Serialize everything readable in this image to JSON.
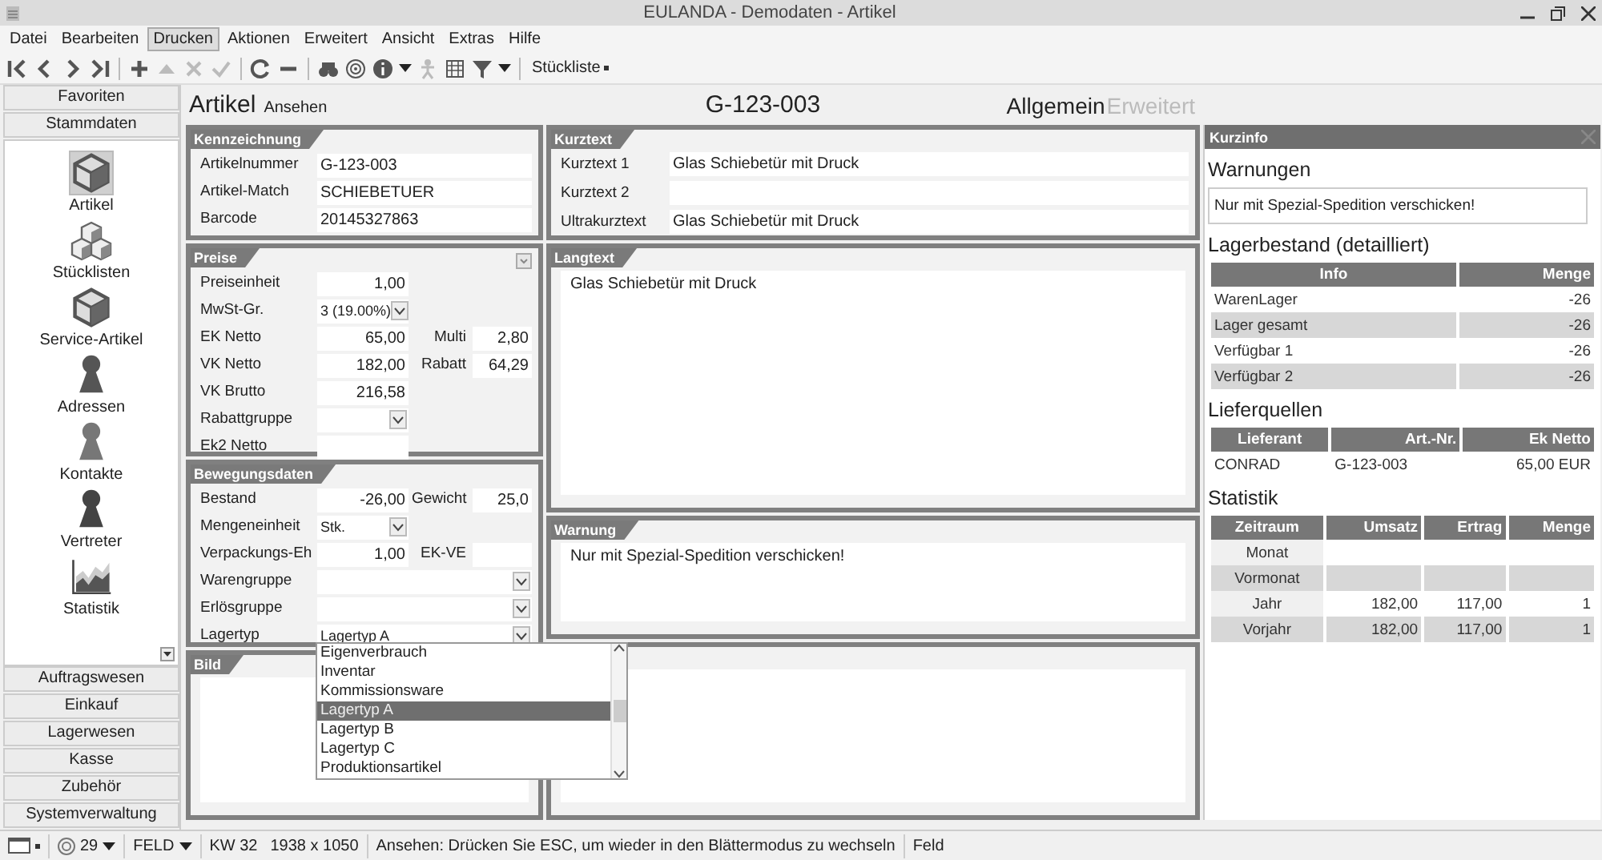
{
  "window": {
    "title": "EULANDA - Demodaten - Artikel"
  },
  "menu": [
    {
      "label": "Datei",
      "selected": false
    },
    {
      "label": "Bearbeiten",
      "selected": false
    },
    {
      "label": "Drucken",
      "selected": true
    },
    {
      "label": "Aktionen",
      "selected": false
    },
    {
      "label": "Erweitert",
      "selected": false
    },
    {
      "label": "Ansicht",
      "selected": false
    },
    {
      "label": "Extras",
      "selected": false
    },
    {
      "label": "Hilfe",
      "selected": false
    }
  ],
  "toolbar": {
    "button_label": "Stückliste"
  },
  "sidebar": {
    "groups_top": [
      "Favoriten"
    ],
    "section": {
      "label": "Stammdaten",
      "items": [
        {
          "label": "Artikel",
          "selected": true
        },
        {
          "label": "Stücklisten",
          "selected": false
        },
        {
          "label": "Service-Artikel",
          "selected": false
        },
        {
          "label": "Adressen",
          "selected": false
        },
        {
          "label": "Kontakte",
          "selected": false
        },
        {
          "label": "Vertreter",
          "selected": false
        },
        {
          "label": "Statistik",
          "selected": false
        }
      ]
    },
    "groups_bottom": [
      "Auftragswesen",
      "Einkauf",
      "Lagerwesen",
      "Kasse",
      "Zubehör",
      "Systemverwaltung"
    ]
  },
  "header": {
    "title": "Artikel",
    "mode": "Ansehen",
    "number": "G-123-003",
    "tabs": [
      {
        "label": "Allgemein",
        "selected": true
      },
      {
        "label": "Erweitert",
        "selected": false
      }
    ]
  },
  "kennzeichnung": {
    "title": "Kennzeichnung",
    "rows": [
      {
        "label": "Artikelnummer",
        "value": "G-123-003",
        "kind": "text"
      },
      {
        "label": "Artikel-Match",
        "value": "SCHIEBETUER",
        "kind": "text"
      },
      {
        "label": "Barcode",
        "value": "20145327863",
        "kind": "text"
      }
    ]
  },
  "preise": {
    "title": "Preise",
    "rows": [
      {
        "label": "Preiseinheit",
        "value": "1,00",
        "kind": "number"
      },
      {
        "label": "MwSt-Gr.",
        "value": "3 (19.00%)",
        "kind": "combo"
      },
      {
        "label": "EK Netto",
        "value": "65,00",
        "kind": "number",
        "right_label": "Multi",
        "right_value": "2,80"
      },
      {
        "label": "VK Netto",
        "value": "182,00",
        "kind": "number",
        "right_label": "Rabatt",
        "right_value": "64,29"
      },
      {
        "label": "VK Brutto",
        "value": "216,58",
        "kind": "number"
      },
      {
        "label": "Rabattgruppe",
        "kind": "combo"
      },
      {
        "label": "Ek2 Netto",
        "kind": "number"
      }
    ]
  },
  "bewegungsdaten": {
    "title": "Bewegungsdaten",
    "rows": [
      {
        "label": "Bestand",
        "value": "-26,00",
        "kind": "number",
        "right_label": "Gewicht",
        "right_value": "25,0"
      },
      {
        "label": "Mengeneinheit",
        "value": "Stk.",
        "kind": "combo"
      },
      {
        "label": "Verpackungs-Eh",
        "value": "1,00",
        "kind": "number",
        "right_label": "EK-VE",
        "right_value": ""
      },
      {
        "label": "Warengruppe",
        "kind": "wide_combo"
      },
      {
        "label": "Erlösgruppe",
        "kind": "wide_combo"
      },
      {
        "label": "Lagertyp",
        "value": "Lagertyp A",
        "kind": "wide_combo"
      }
    ],
    "dropdown": [
      {
        "label": "Eigenverbrauch",
        "selected": false
      },
      {
        "label": "Inventar",
        "selected": false
      },
      {
        "label": "Kommissionsware",
        "selected": false
      },
      {
        "label": "Lagertyp A",
        "selected": true
      },
      {
        "label": "Lagertyp B",
        "selected": false
      },
      {
        "label": "Lagertyp C",
        "selected": false
      },
      {
        "label": "Produktionsartikel",
        "selected": false
      }
    ]
  },
  "bild": {
    "title": "Bild"
  },
  "kurztext": {
    "title": "Kurztext",
    "rows": [
      {
        "label": "Kurztext 1",
        "value": "Glas Schiebetür mit Druck"
      },
      {
        "label": "Kurztext 2"
      },
      {
        "label": "Ultrakurztext",
        "value": "Glas Schiebetür mit Druck"
      }
    ]
  },
  "langtext": {
    "title": "Langtext",
    "text": "Glas Schiebetür mit Druck"
  },
  "warnung": {
    "title": "Warnung",
    "text": "Nur mit Spezial-Spedition verschicken!"
  },
  "kurzinfo": {
    "title": "Kurzinfo",
    "warnungen": {
      "title": "Warnungen",
      "text": "Nur mit Spezial-Spedition verschicken!"
    },
    "lagerbestand": {
      "title": "Lagerbestand (detailliert)",
      "columns": [
        "Info",
        "Menge"
      ],
      "rows": [
        [
          "WarenLager",
          "-26"
        ],
        [
          "Lager gesamt",
          "-26"
        ],
        [
          "Verfügbar 1",
          "-26"
        ],
        [
          "Verfügbar 2",
          "-26"
        ]
      ]
    },
    "lieferquellen": {
      "title": "Lieferquellen",
      "columns": [
        "Lieferant",
        "Art.-Nr.",
        "Ek Netto"
      ],
      "rows": [
        [
          "CONRAD",
          "G-123-003",
          "65,00 EUR"
        ]
      ]
    },
    "statistik": {
      "title": "Statistik",
      "columns": [
        "Zeitraum",
        "Umsatz",
        "Ertrag",
        "Menge"
      ],
      "rows": [
        [
          "Monat",
          "",
          "",
          ""
        ],
        [
          "Vormonat",
          "",
          "",
          ""
        ],
        [
          "Jahr",
          "182,00",
          "117,00",
          "1"
        ],
        [
          "Vorjahr",
          "182,00",
          "117,00",
          "1"
        ]
      ]
    }
  },
  "status_bar": {
    "zoom": "29",
    "mode": "FELD",
    "week": "KW 32",
    "resolution": "1938 x 1050",
    "message": "Ansehen: Drücken Sie ESC, um wieder in den Blättermodus zu wechseln",
    "field": "Feld"
  }
}
